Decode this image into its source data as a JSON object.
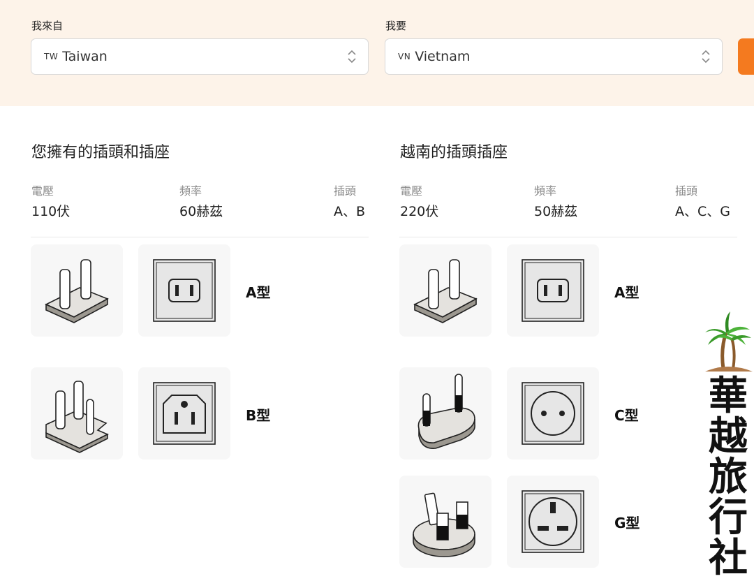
{
  "header": {
    "from_label": "我來自",
    "to_label": "我要",
    "from_select": {
      "code": "TW",
      "value": "Taiwan"
    },
    "to_select": {
      "code": "VN",
      "value": "Vietnam"
    }
  },
  "left": {
    "title": "您擁有的插頭和插座",
    "voltage_label": "電壓",
    "voltage": "110伏",
    "freq_label": "頻率",
    "freq": "60赫茲",
    "plug_label": "插頭",
    "plugs": "A、B",
    "types": [
      "A型",
      "B型"
    ]
  },
  "right": {
    "title": "越南的插頭插座",
    "voltage_label": "電壓",
    "voltage": "220伏",
    "freq_label": "頻率",
    "freq": "50赫茲",
    "plug_label": "插頭",
    "plugs": "A、C、G",
    "types": [
      "A型",
      "C型",
      "G型"
    ]
  },
  "logo": {
    "chars": [
      "華",
      "越",
      "旅",
      "行",
      "社"
    ]
  },
  "colors": {
    "header_bg": "#fdf3e9",
    "accent": "#f47a1f",
    "tile_bg": "#f7f7f7"
  }
}
